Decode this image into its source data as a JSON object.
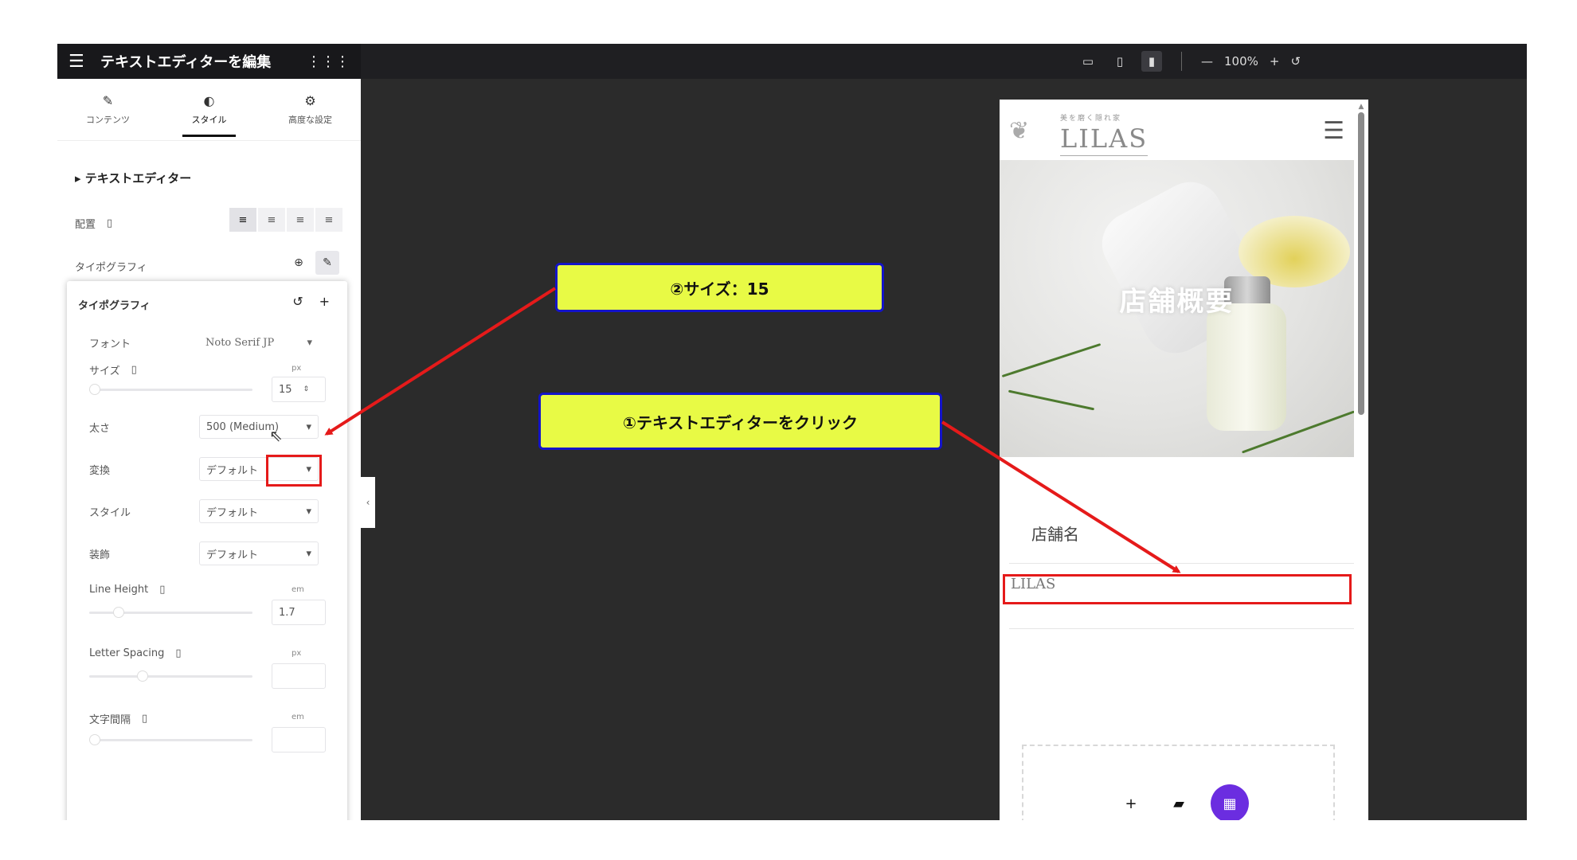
{
  "topbar": {
    "title": "テキストエディターを編集",
    "zoom": "100%",
    "icons": [
      "menu-icon",
      "apps-grid-icon",
      "desktop-icon",
      "tablet-icon",
      "mobile-icon",
      "zoom-out-icon",
      "zoom-in-icon",
      "reset-icon"
    ]
  },
  "tabs": [
    {
      "label": "コンテンツ",
      "icon": "pencil-icon"
    },
    {
      "label": "スタイル",
      "icon": "contrast-icon",
      "active": true
    },
    {
      "label": "高度な設定",
      "icon": "gear-icon"
    }
  ],
  "section": {
    "title": "テキストエディター",
    "align_label": "配置",
    "typography_label": "タイポグラフィ"
  },
  "popover": {
    "title": "タイポグラフィ",
    "font_label": "フォント",
    "font_value": "Noto Serif JP",
    "size_label": "サイズ",
    "size_unit": "px",
    "size_value": "15",
    "weight_label": "太さ",
    "weight_value": "500 (Medium)",
    "transform_label": "変換",
    "transform_value": "デフォルト",
    "style_label": "スタイル",
    "style_value": "デフォルト",
    "decoration_label": "装飾",
    "decoration_value": "デフォルト",
    "line_height_label": "Line Height",
    "line_height_unit": "em",
    "line_height_value": "1.7",
    "letter_spacing_label": "Letter Spacing",
    "letter_spacing_unit": "px",
    "word_spacing_label": "文字間隔",
    "word_spacing_unit": "em"
  },
  "preview": {
    "logo_sub": "美を磨く隠れ家",
    "logo_main": "LILAS",
    "hero_title": "店舗概要",
    "store_label": "店舗名",
    "store_value": "LILAS"
  },
  "callouts": {
    "step1": "①テキストエディターをクリック",
    "step2": "②サイズ：15"
  },
  "colors": {
    "highlight": "#e51a1a",
    "callout_bg": "#e8fa45",
    "callout_border": "#1414c8",
    "accent_purple": "#6b2de0"
  }
}
